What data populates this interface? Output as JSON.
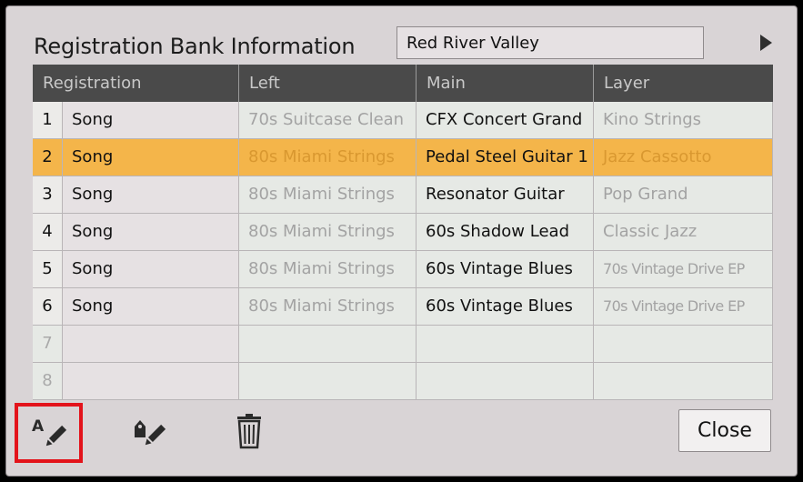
{
  "dialog": {
    "title": "Registration Bank Information",
    "bank_name": "Red River Valley",
    "next_icon": "triangle-right-icon"
  },
  "table": {
    "headers": [
      "Registration",
      "Left",
      "Main",
      "Layer"
    ],
    "rows": [
      {
        "num": "1",
        "name": "Song",
        "left": "70s Suitcase Clean",
        "main": "CFX Concert Grand",
        "layer": "Kino Strings"
      },
      {
        "num": "2",
        "name": "Song",
        "left": "80s Miami Strings",
        "main": "Pedal Steel Guitar 1",
        "layer": "Jazz Cassotto"
      },
      {
        "num": "3",
        "name": "Song",
        "left": "80s Miami Strings",
        "main": "Resonator Guitar",
        "layer": "Pop Grand"
      },
      {
        "num": "4",
        "name": "Song",
        "left": "80s Miami Strings",
        "main": "60s Shadow Lead",
        "layer": "Classic Jazz"
      },
      {
        "num": "5",
        "name": "Song",
        "left": "80s Miami Strings",
        "main": "60s Vintage Blues",
        "layer": "70s Vintage Drive EP"
      },
      {
        "num": "6",
        "name": "Song",
        "left": "80s Miami Strings",
        "main": "60s Vintage Blues",
        "layer": "70s Vintage Drive EP"
      },
      {
        "num": "7",
        "name": "",
        "left": "",
        "main": "",
        "layer": ""
      },
      {
        "num": "8",
        "name": "",
        "left": "",
        "main": "",
        "layer": ""
      }
    ],
    "selected_row": "2"
  },
  "toolbar": {
    "rename_icon": "text-edit-icon",
    "tag_icon": "tag-edit-icon",
    "delete_icon": "trash-icon",
    "close_label": "Close"
  },
  "colors": {
    "selected_row": "#f4b54a",
    "header": "#4a4a4a",
    "highlight_box": "#e3131b"
  }
}
